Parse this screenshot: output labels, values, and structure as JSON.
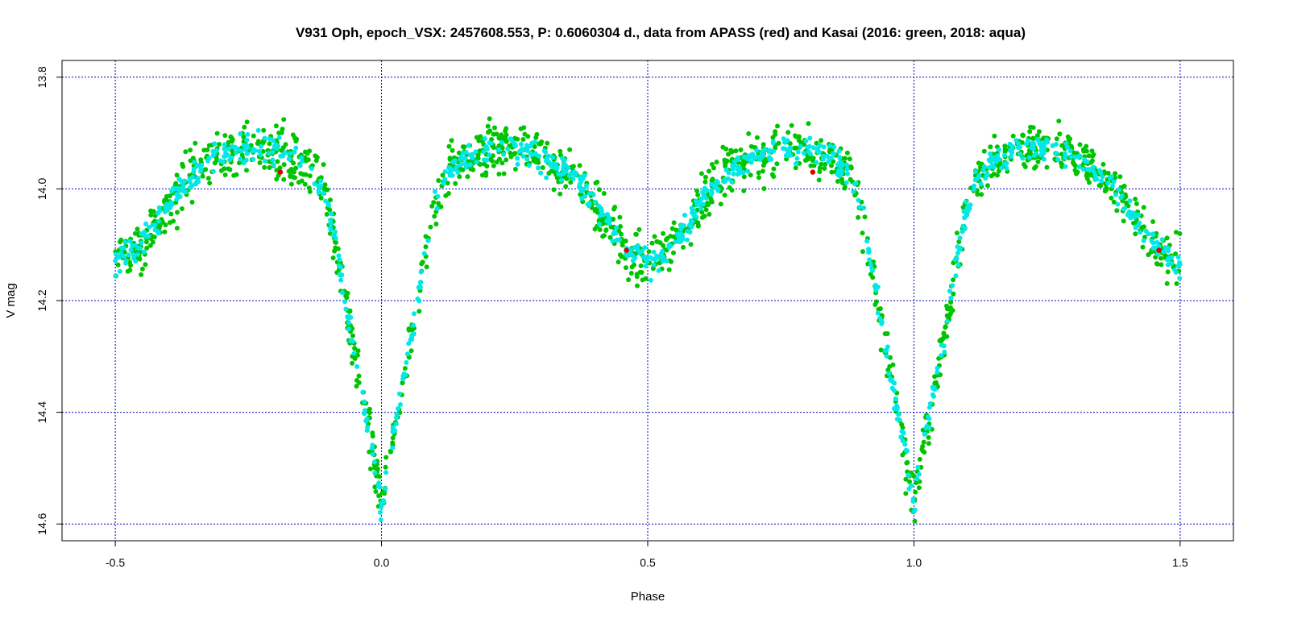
{
  "chart_data": {
    "type": "scatter",
    "title": "V931 Oph, epoch_VSX: 2457608.553, P: 0.6060304 d., data from APASS (red) and Kasai (2016: green, 2018: aqua)",
    "xlabel": "Phase",
    "ylabel": "V mag",
    "xlim": [
      -0.6,
      1.6
    ],
    "ylim": [
      14.63,
      13.77
    ],
    "y_inverted": true,
    "grid": true,
    "x_ticks": [
      -0.5,
      0.0,
      0.5,
      1.0,
      1.5
    ],
    "x_tick_labels": [
      "-0.5",
      "0.0",
      "0.5",
      "1.0",
      "1.5"
    ],
    "y_ticks": [
      13.8,
      14.0,
      14.2,
      14.4,
      14.6
    ],
    "y_tick_labels": [
      "13.8",
      "14.0",
      "14.2",
      "14.4",
      "14.6"
    ],
    "colors": {
      "grid": "#0000cc",
      "kasai_2016": "#00c400",
      "kasai_2018": "#00e8e8",
      "apass": "#e00000"
    },
    "light_curve_shape": {
      "phase": [
        0.0,
        0.02,
        0.04,
        0.06,
        0.08,
        0.1,
        0.12,
        0.15,
        0.2,
        0.25,
        0.3,
        0.35,
        0.38,
        0.42,
        0.46,
        0.5
      ],
      "mag": [
        14.57,
        14.45,
        14.35,
        14.25,
        14.13,
        14.03,
        13.98,
        13.95,
        13.93,
        13.925,
        13.94,
        13.97,
        14.0,
        14.06,
        14.11,
        14.135
      ]
    },
    "series": [
      {
        "name": "Kasai (2016: green)",
        "color": "#00c400",
        "points": 1400,
        "phase_range": [
          -0.5,
          1.5
        ],
        "scatter_mag": 0.022
      },
      {
        "name": "Kasai (2018: aqua)",
        "color": "#00e8e8",
        "points": 900,
        "phase_range": [
          -0.5,
          1.5
        ],
        "scatter_mag": 0.012
      },
      {
        "name": "APASS (red)",
        "color": "#e00000",
        "x": [
          -0.19,
          0.81,
          0.46,
          1.46
        ],
        "y": [
          13.97,
          13.97,
          14.11,
          14.11
        ]
      }
    ]
  }
}
